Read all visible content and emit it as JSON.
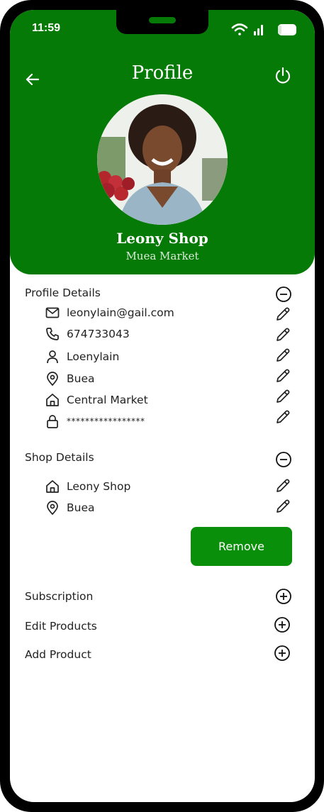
{
  "status_bar": {
    "time": "11:59"
  },
  "header": {
    "title": "Profile",
    "shop_name": "Leony Shop",
    "market_name": "Muea Market"
  },
  "profile_details": {
    "label": "Profile Details",
    "items": [
      {
        "icon": "mail-icon",
        "value": "leonylain@gail.com"
      },
      {
        "icon": "phone-icon",
        "value": "674733043"
      },
      {
        "icon": "user-icon",
        "value": "Loenylain"
      },
      {
        "icon": "location-pin-icon",
        "value": "Buea"
      },
      {
        "icon": "home-icon",
        "value": "Central Market"
      },
      {
        "icon": "lock-icon",
        "value": "*****************"
      }
    ]
  },
  "shop_details": {
    "label": "Shop Details",
    "items": [
      {
        "icon": "home-icon",
        "value": "Leony Shop"
      },
      {
        "icon": "location-pin-icon",
        "value": "Buea"
      }
    ],
    "remove_label": "Remove"
  },
  "menu": {
    "subscription": "Subscription",
    "edit_products": "Edit Products",
    "add_product": "Add Product"
  },
  "colors": {
    "header_green": "#067a06",
    "button_green": "#0a8f0a"
  }
}
